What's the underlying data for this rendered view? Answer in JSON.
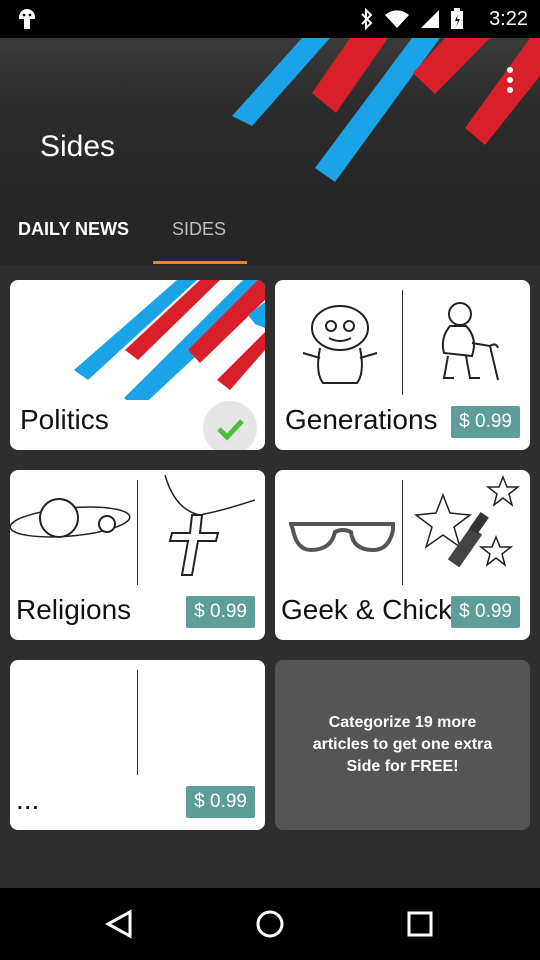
{
  "status_bar": {
    "time": "3:22",
    "icons": [
      "android-icon",
      "bluetooth-icon",
      "wifi-icon",
      "signal-icon",
      "battery-icon"
    ]
  },
  "header": {
    "title": "Sides",
    "colors": {
      "blue": "#1aa3e6",
      "red": "#d9202a"
    }
  },
  "tabs": [
    {
      "label": "DAILY NEWS",
      "active": false
    },
    {
      "label": "SIDES",
      "active": true
    }
  ],
  "cards": [
    {
      "label": "Politics",
      "owned": true
    },
    {
      "label": "Generations",
      "price": "$ 0.99"
    },
    {
      "label": "Religions",
      "price": "$ 0.99"
    },
    {
      "label": "Geek & Chick",
      "price": "$ 0.99"
    },
    {
      "label": "...",
      "price": "$ 0.99"
    }
  ],
  "promo": {
    "text": "Categorize 19 more articles to get one extra Side for FREE!"
  },
  "nav": {
    "icons": [
      "back-icon",
      "home-icon",
      "recents-icon"
    ]
  },
  "accent": "#e48a1c",
  "price_color": "#5d9e98"
}
